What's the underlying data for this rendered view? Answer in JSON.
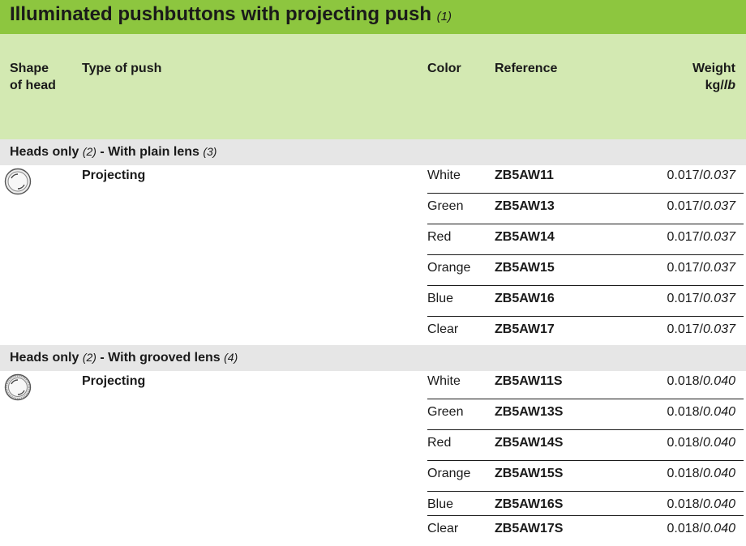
{
  "title": {
    "text": "Illuminated pushbuttons with projecting push",
    "note": "(1)"
  },
  "columns": {
    "shape": "Shape",
    "shape2": "of head",
    "type": "Type of push",
    "color": "Color",
    "reference": "Reference",
    "weight": "Weight",
    "weight_kg": "kg/",
    "weight_lb": "lb"
  },
  "sections": [
    {
      "title_a": "Heads only",
      "note_a": "(2)",
      "title_b": " - With plain lens",
      "note_b": "(3)",
      "icon": "plain-lens-head-icon",
      "type_of_push": "Projecting",
      "rows": [
        {
          "color": "White",
          "reference": "ZB5AW11",
          "weight_kg": "0.017/",
          "weight_lb": "0.037"
        },
        {
          "color": "Green",
          "reference": "ZB5AW13",
          "weight_kg": "0.017/",
          "weight_lb": "0.037"
        },
        {
          "color": "Red",
          "reference": "ZB5AW14",
          "weight_kg": "0.017/",
          "weight_lb": "0.037"
        },
        {
          "color": "Orange",
          "reference": "ZB5AW15",
          "weight_kg": "0.017/",
          "weight_lb": "0.037"
        },
        {
          "color": "Blue",
          "reference": "ZB5AW16",
          "weight_kg": "0.017/",
          "weight_lb": "0.037"
        },
        {
          "color": "Clear",
          "reference": "ZB5AW17",
          "weight_kg": "0.017/",
          "weight_lb": "0.037"
        }
      ]
    },
    {
      "title_a": "Heads only",
      "note_a": "(2)",
      "title_b": " - With grooved lens",
      "note_b": "(4)",
      "icon": "grooved-lens-head-icon",
      "type_of_push": "Projecting",
      "rows": [
        {
          "color": "White",
          "reference": "ZB5AW11S",
          "weight_kg": "0.018/",
          "weight_lb": "0.040"
        },
        {
          "color": "Green",
          "reference": "ZB5AW13S",
          "weight_kg": "0.018/",
          "weight_lb": "0.040"
        },
        {
          "color": "Red",
          "reference": "ZB5AW14S",
          "weight_kg": "0.018/",
          "weight_lb": "0.040"
        },
        {
          "color": "Orange",
          "reference": "ZB5AW15S",
          "weight_kg": "0.018/",
          "weight_lb": "0.040"
        },
        {
          "color": "Blue",
          "reference": "ZB5AW16S",
          "weight_kg": "0.018/",
          "weight_lb": "0.040"
        },
        {
          "color": "Clear",
          "reference": "ZB5AW17S",
          "weight_kg": "0.018/",
          "weight_lb": "0.040"
        }
      ]
    }
  ],
  "colors": {
    "title_bar": "#8dc63f",
    "header_band": "#d3e9b2",
    "section_band": "#e6e6e6"
  }
}
